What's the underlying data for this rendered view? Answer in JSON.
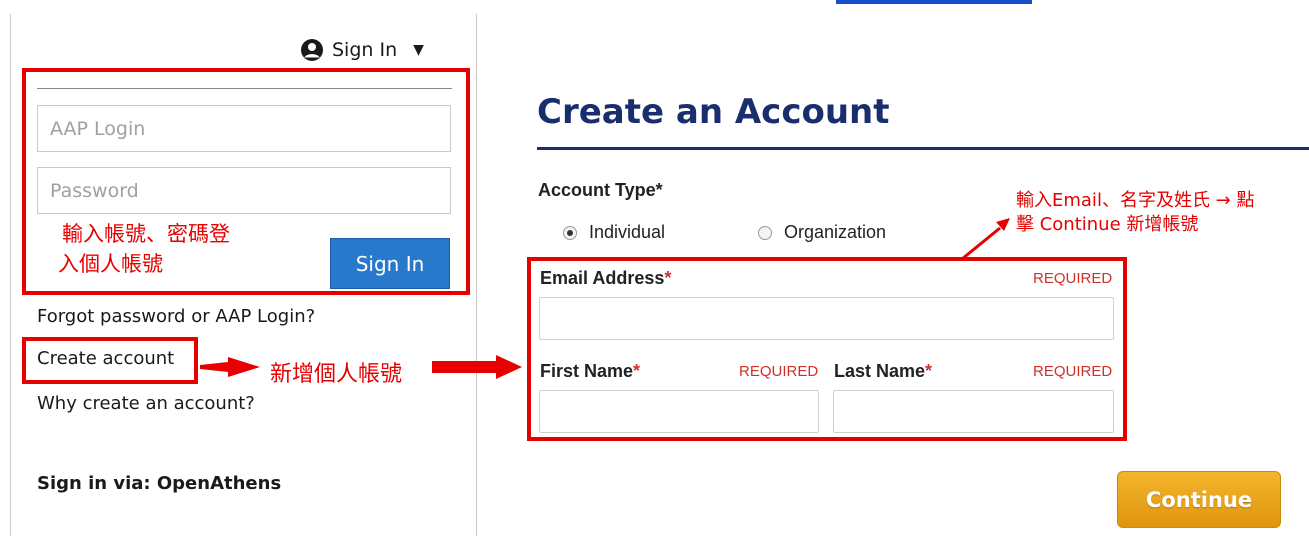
{
  "header": {
    "signin_menu_label": "Sign In",
    "signin_caret": "▼"
  },
  "login": {
    "username_placeholder": "AAP Login",
    "password_placeholder": "Password",
    "signin_button": "Sign In",
    "annotation_line1": "輸入帳號、密碼登",
    "annotation_line2": "入個人帳號"
  },
  "links": {
    "forgot": "Forgot password or AAP Login?",
    "create": "Create account",
    "why": "Why create an account?",
    "openathens": "Sign in via: OpenAthens",
    "create_annotation": "新增個人帳號"
  },
  "form": {
    "title": "Create an Account",
    "account_type_label": "Account Type*",
    "account_types": [
      "Individual",
      "Organization"
    ],
    "selected_account_type": "Individual",
    "email_label": "Email Address",
    "first_name_label": "First Name",
    "last_name_label": "Last Name",
    "required_star": "*",
    "required_text": "REQUIRED",
    "continue_button": "Continue",
    "annotation_line1": "輸入Email、名字及姓氏 → 點",
    "annotation_line2": "擊 Continue 新增帳號"
  },
  "colors": {
    "annotation_red": "#e60000",
    "heading_navy": "#1a2e6e",
    "signin_blue": "#2879cc",
    "continue_orange": "#e8a21c"
  }
}
